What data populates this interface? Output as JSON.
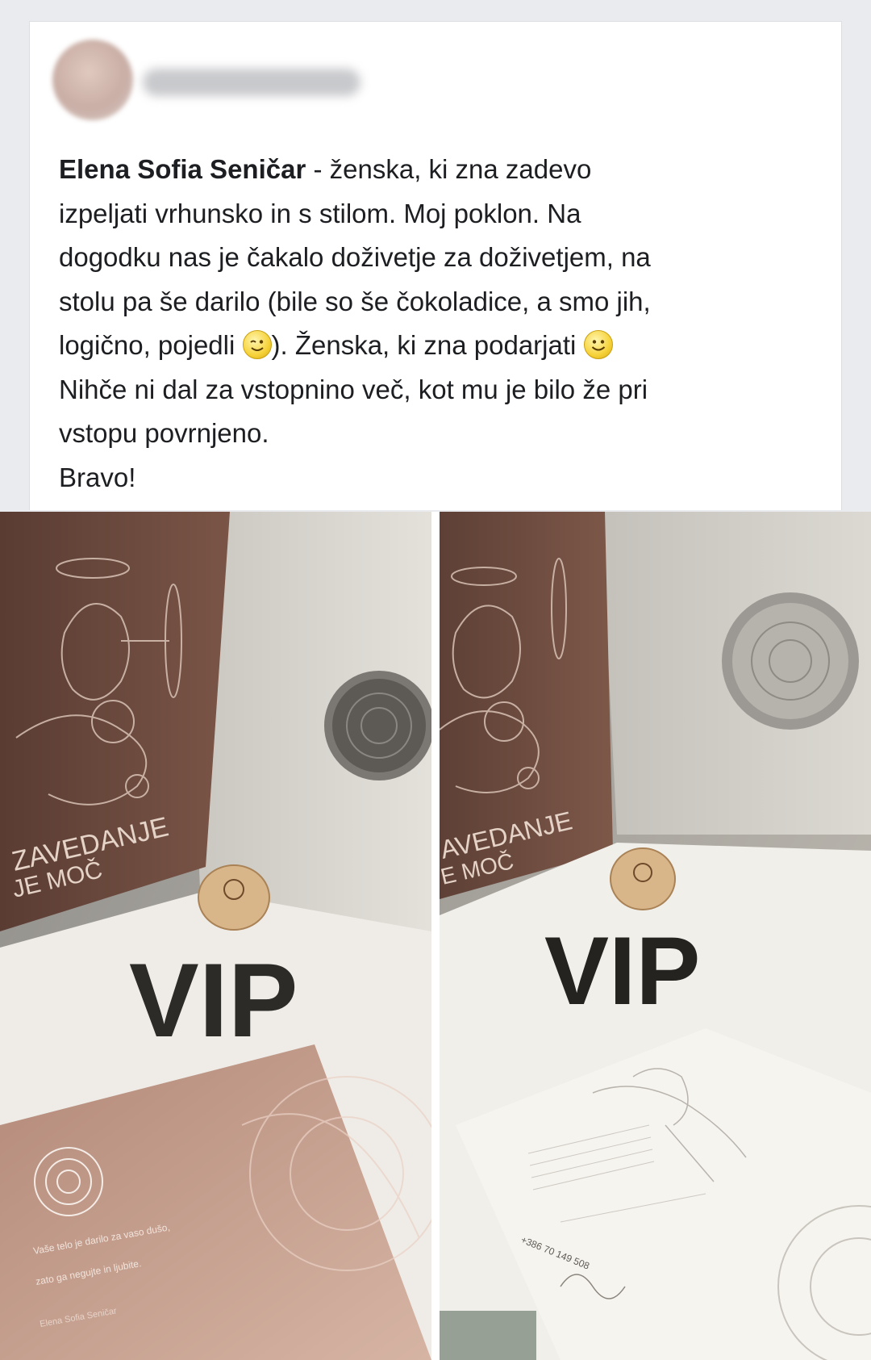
{
  "post": {
    "author_name": "Elena Sofia Seničar",
    "text_lines": [
      " - ženska, ki zna zadevo",
      "izpeljati vrhunsko in s stilom. Moj poklon. Na",
      "dogodku nas je čakalo doživetje za doživetjem, na",
      "stolu pa še darilo (bile so še čokoladice, a smo jih,",
      "logično, pojedli ",
      "). Ženska, ki zna podarjati ",
      "Nihče ni dal za vstopnino več, kot mu je bilo že pri",
      "vstopu povrnjeno.",
      "Bravo!"
    ],
    "emoji_wink": "wink-emoji",
    "emoji_smile": "smile-emoji"
  },
  "photos": {
    "left": {
      "bag_text_line1": "ZAVEDANJE",
      "bag_text_line2": "JE MOČ",
      "card_text": "VIP",
      "booklet_line1": "Vaše telo je darilo za vaso dušo,",
      "booklet_line2": "zato ga negujte in ljubite.",
      "booklet_line3": "Elena Sofia Seničar"
    },
    "right": {
      "bag_text_line1": "AVEDANJE",
      "bag_text_line2": "E MOČ",
      "card_text": "VIP",
      "letter_phone": "+386 70 149 508"
    }
  },
  "colors": {
    "bag_brown": "#6b4a3f",
    "card_white": "#f2f0ec",
    "booklet_rose": "#c29a88"
  }
}
